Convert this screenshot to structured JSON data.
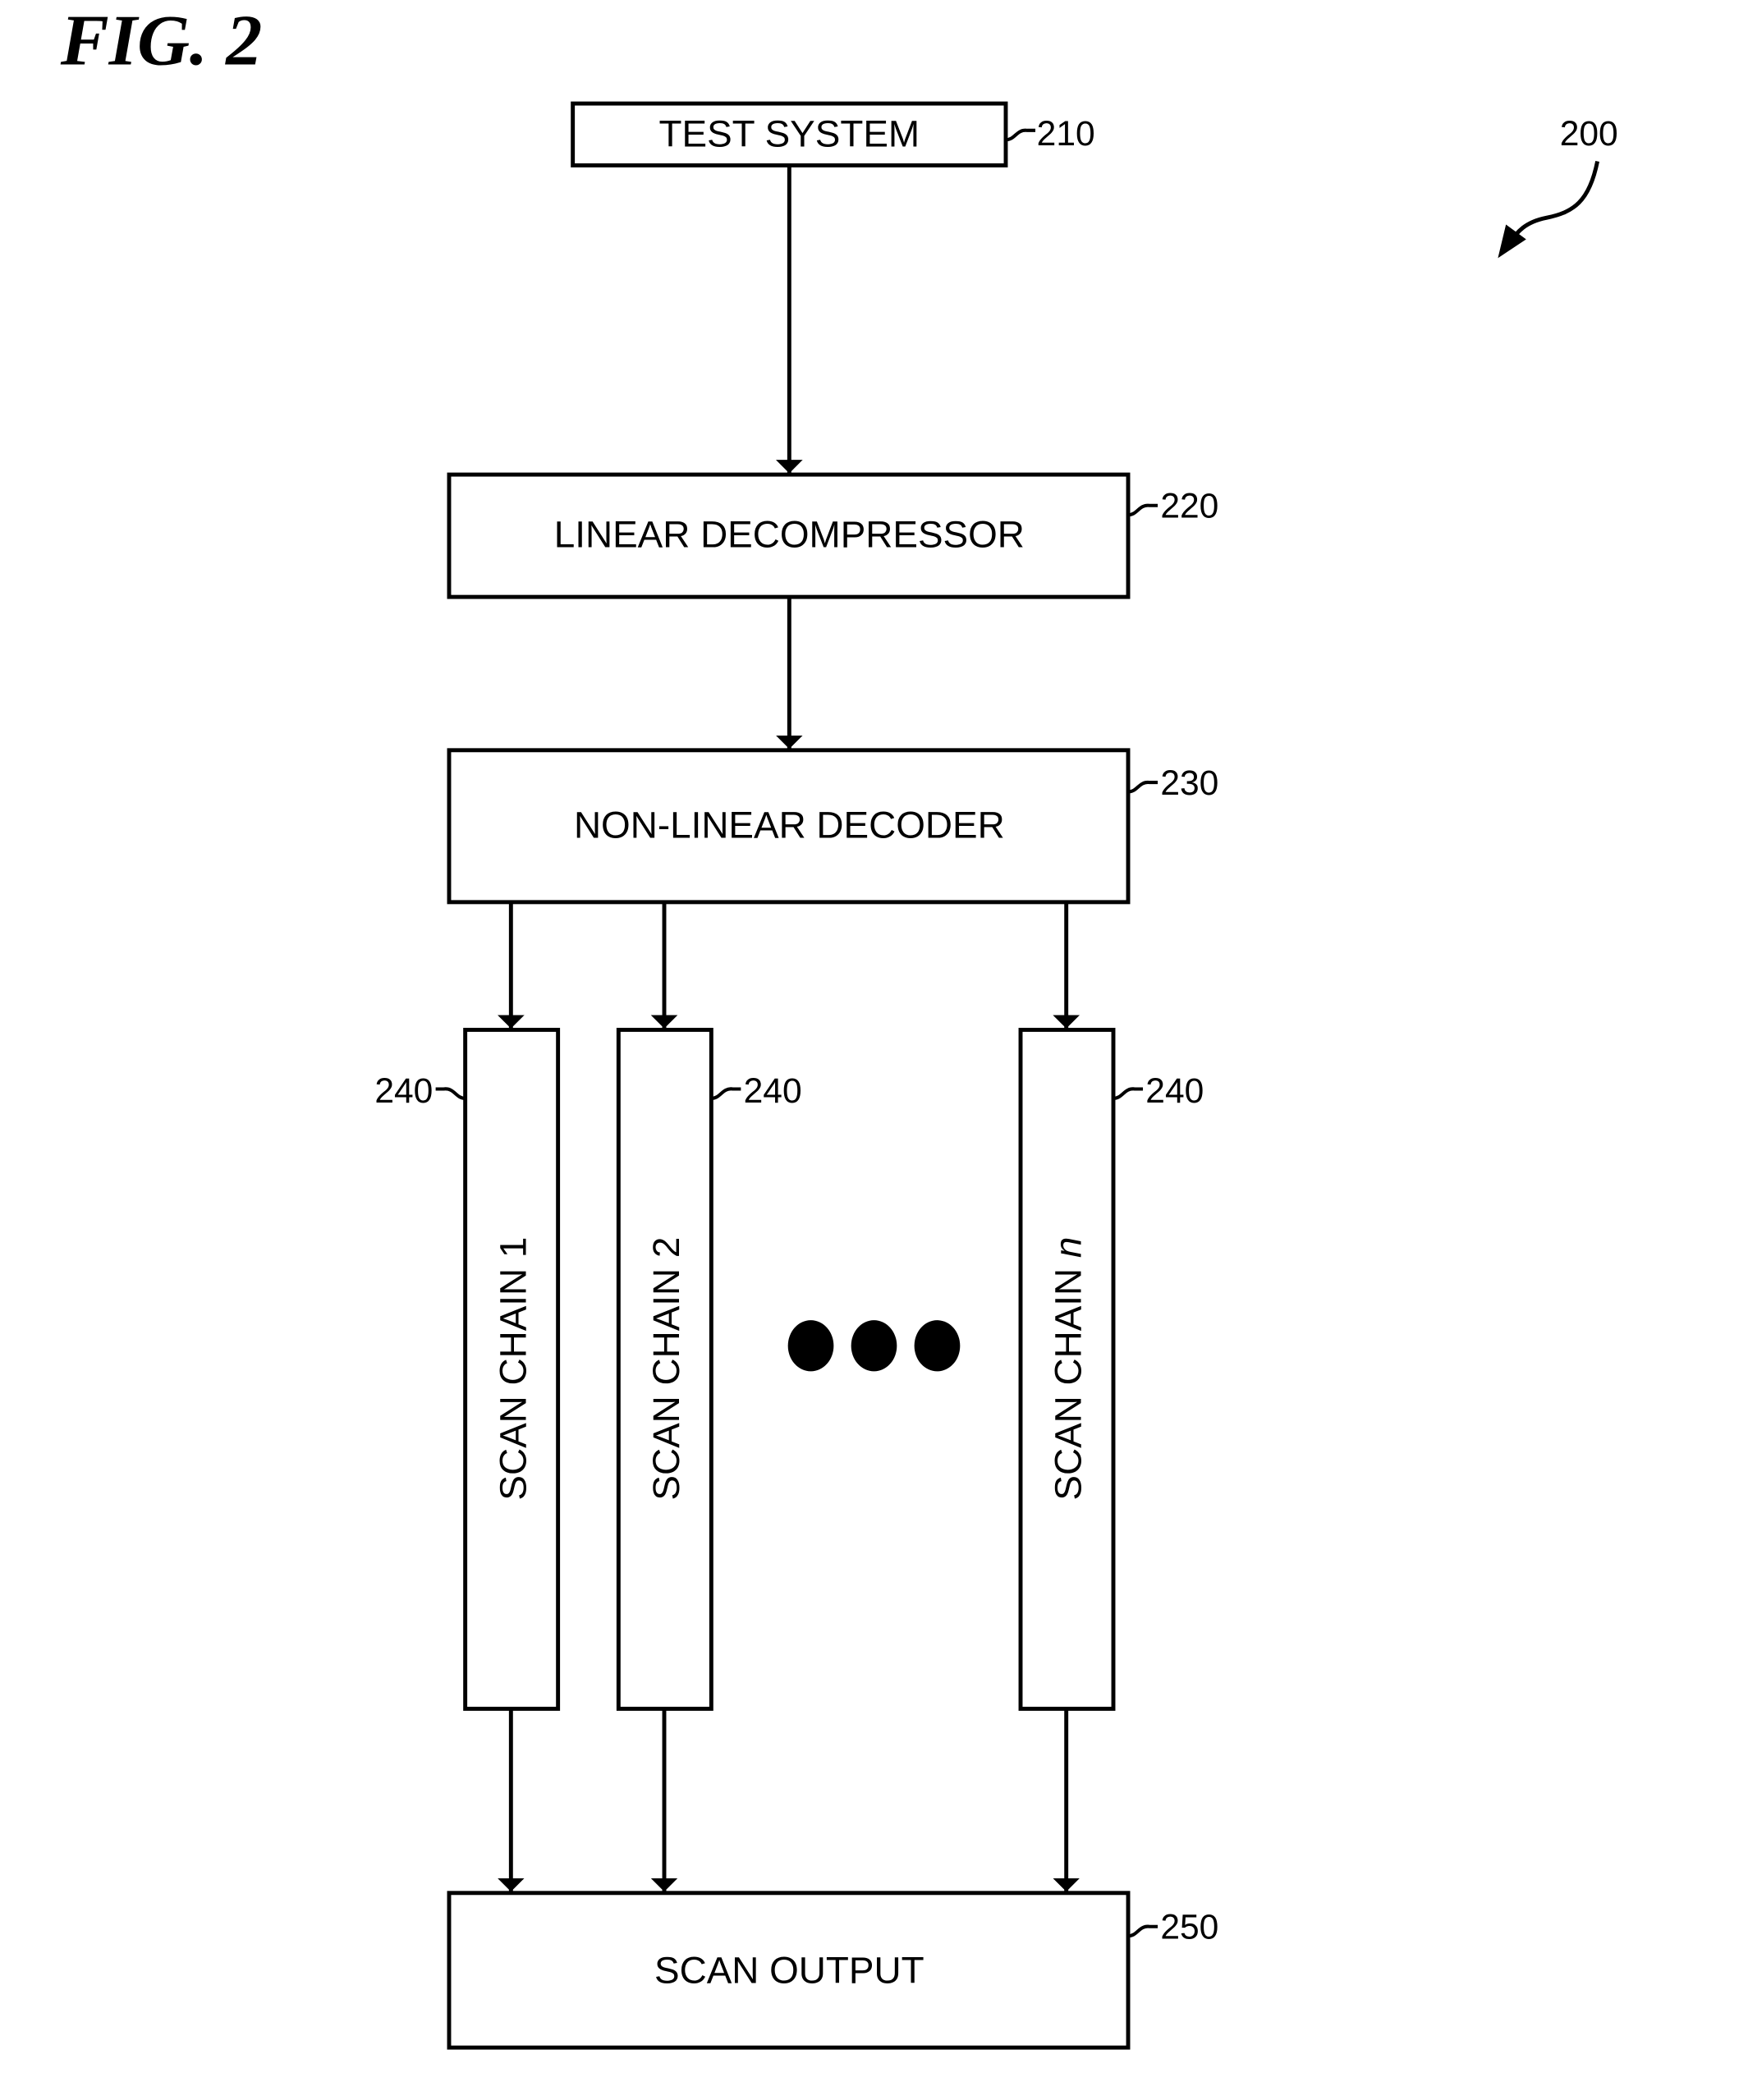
{
  "figure": {
    "title": "FIG. 2",
    "ref_number": "200"
  },
  "blocks": {
    "test_system": {
      "label": "TEST SYSTEM",
      "ref": "210"
    },
    "linear_decompressor": {
      "label": "LINEAR DECOMPRESSOR",
      "ref": "220"
    },
    "non_linear_decoder": {
      "label": "NON-LINEAR DECODER",
      "ref": "230"
    },
    "scan_output": {
      "label": "SCAN OUTPUT",
      "ref": "250"
    }
  },
  "scan_chains": [
    {
      "label": "SCAN CHAIN 1",
      "prefix": "SCAN CHAIN ",
      "suffix": "1",
      "suffix_italic": false,
      "ref": "240"
    },
    {
      "label": "SCAN CHAIN 2",
      "prefix": "SCAN CHAIN ",
      "suffix": "2",
      "suffix_italic": false,
      "ref": "240"
    },
    {
      "label": "SCAN CHAIN n",
      "prefix": "SCAN CHAIN ",
      "suffix": "n",
      "suffix_italic": true,
      "ref": "240"
    }
  ],
  "ellipsis": "more scan chains (ellipsis)",
  "colors": {
    "ink": "#000000",
    "paper": "#ffffff"
  }
}
